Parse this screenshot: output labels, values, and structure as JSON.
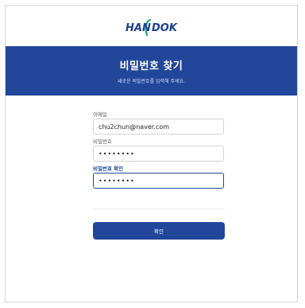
{
  "brand": {
    "logo_text": "HANDOK",
    "brand_color": "#22479a"
  },
  "banner": {
    "title": "비밀번호 찾기",
    "subtitle": "새로운 비밀번호를 입력해 주세요."
  },
  "form": {
    "email_label": "이메일",
    "email_value": "chu2chun@naver.com",
    "password_label": "비밀번호",
    "password_value": "••••••••",
    "confirm_label": "비밀번호 확인",
    "confirm_value": "••••••••"
  },
  "actions": {
    "submit_label": "확인"
  }
}
